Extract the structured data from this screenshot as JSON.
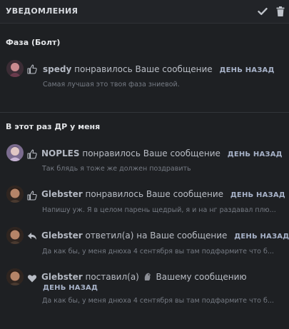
{
  "header": {
    "title": "УВЕДОМЛЕНИЯ",
    "check_icon": "check-icon",
    "trash_icon": "trash-icon"
  },
  "sections": [
    {
      "title": "Фаза (Болт)",
      "items": [
        {
          "user": "spedy",
          "action": "понравилось Ваше сообщение",
          "time": "ДЕНЬ НАЗАД",
          "preview": "Самая лучшая это твоя фаза зниевой.",
          "icon": "thumbs-up-icon"
        }
      ]
    },
    {
      "title": "В этот раз ДР у меня",
      "items": [
        {
          "user": "NOPLES",
          "action": "понравилось Ваше сообщение",
          "time": "ДЕНЬ НАЗАД",
          "preview": "Так блядь я тоже же должен поздравить",
          "icon": "thumbs-up-icon"
        },
        {
          "user": "Glebster",
          "action": "понравилось Ваше сообщение",
          "time": "ДЕНЬ НАЗАД",
          "preview": "Напишу уж. Я в целом парень щедрый, я и на нг раздавал плю...",
          "icon": "thumbs-up-icon"
        },
        {
          "user": "Glebster",
          "action": "ответил(а) на Ваше сообщение",
          "time": "ДЕНЬ НАЗАД",
          "preview": "Да как бы, у меня днюха 4 сентября вы там подфармите что б...",
          "icon": "reply-icon"
        },
        {
          "user": "Glebster",
          "action": "поставил(а)",
          "action_after": "Вашему сообщению",
          "time": "ДЕНЬ НАЗАД",
          "preview": "Да как бы, у меня днюха 4 сентября вы там подфармите что б...",
          "icon": "heart-icon"
        }
      ]
    }
  ],
  "colors": {
    "background": "#1e2023",
    "time": "#a7b2c8",
    "preview": "#767b84"
  }
}
